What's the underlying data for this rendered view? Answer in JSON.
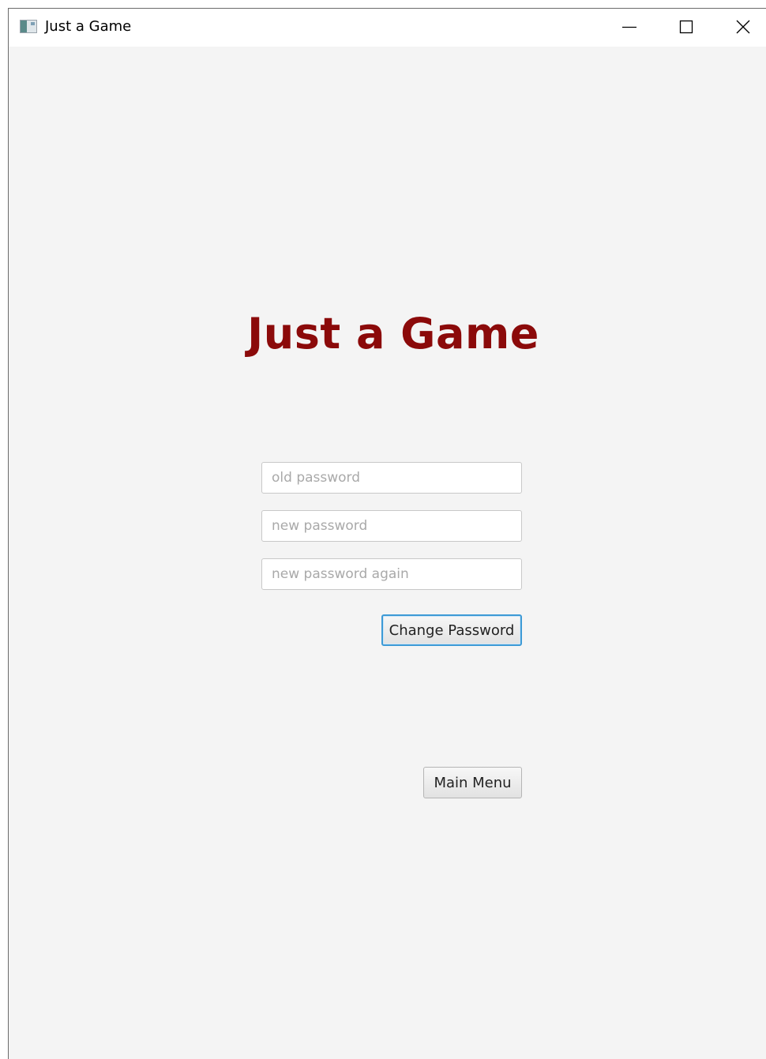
{
  "window": {
    "title": "Just a Game",
    "icon": "app-window-icon",
    "controls": {
      "minimize": "minimize-icon",
      "maximize": "maximize-icon",
      "close": "close-icon"
    }
  },
  "main": {
    "heading": "Just a Game",
    "heading_color": "#8b0a0a",
    "fields": {
      "old_password": {
        "placeholder": "old password",
        "value": ""
      },
      "new_password": {
        "placeholder": "new password",
        "value": ""
      },
      "new_password_again": {
        "placeholder": "new password again",
        "value": ""
      }
    },
    "change_password_label": "Change Password",
    "main_menu_label": "Main Menu"
  },
  "colors": {
    "background": "#f4f4f4",
    "focus_accent": "#3d9ad6"
  }
}
